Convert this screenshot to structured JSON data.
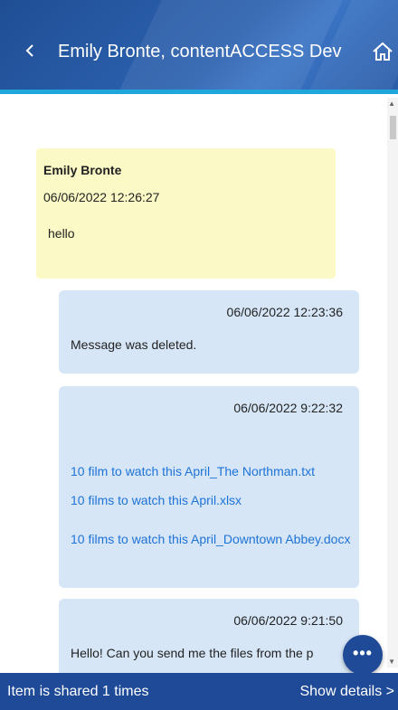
{
  "header": {
    "back_glyph": "<",
    "title": "Emily Bronte, contentACCESS Dev",
    "home_icon": "home-icon"
  },
  "messages": [
    {
      "author": "Emily Bronte",
      "timestamp": "06/06/2022 12:26:27",
      "text": "hello"
    },
    {
      "timestamp": "06/06/2022 12:23:36",
      "text": "Message was deleted."
    },
    {
      "timestamp": "06/06/2022 9:22:32",
      "attachments": [
        "10 film to watch this April_The Northman.txt",
        "10 films to watch this April.xlsx",
        "10 films to watch this April_Downtown Abbey.docx"
      ]
    },
    {
      "timestamp": "06/06/2022 9:21:50",
      "text": "Hello! Can you send me the files from the p"
    }
  ],
  "fab": {
    "label": "•••"
  },
  "footer": {
    "shared_text": "Item is shared 1 times",
    "details_label": "Show details",
    "details_glyph": ">"
  },
  "colors": {
    "header_bg": "#2a5ca8",
    "accent_line": "#1fa7dc",
    "received_bubble": "#fbfac6",
    "sent_bubble": "#d6e6f7",
    "link": "#1e73d6",
    "footer_bg": "#1f4a98"
  }
}
